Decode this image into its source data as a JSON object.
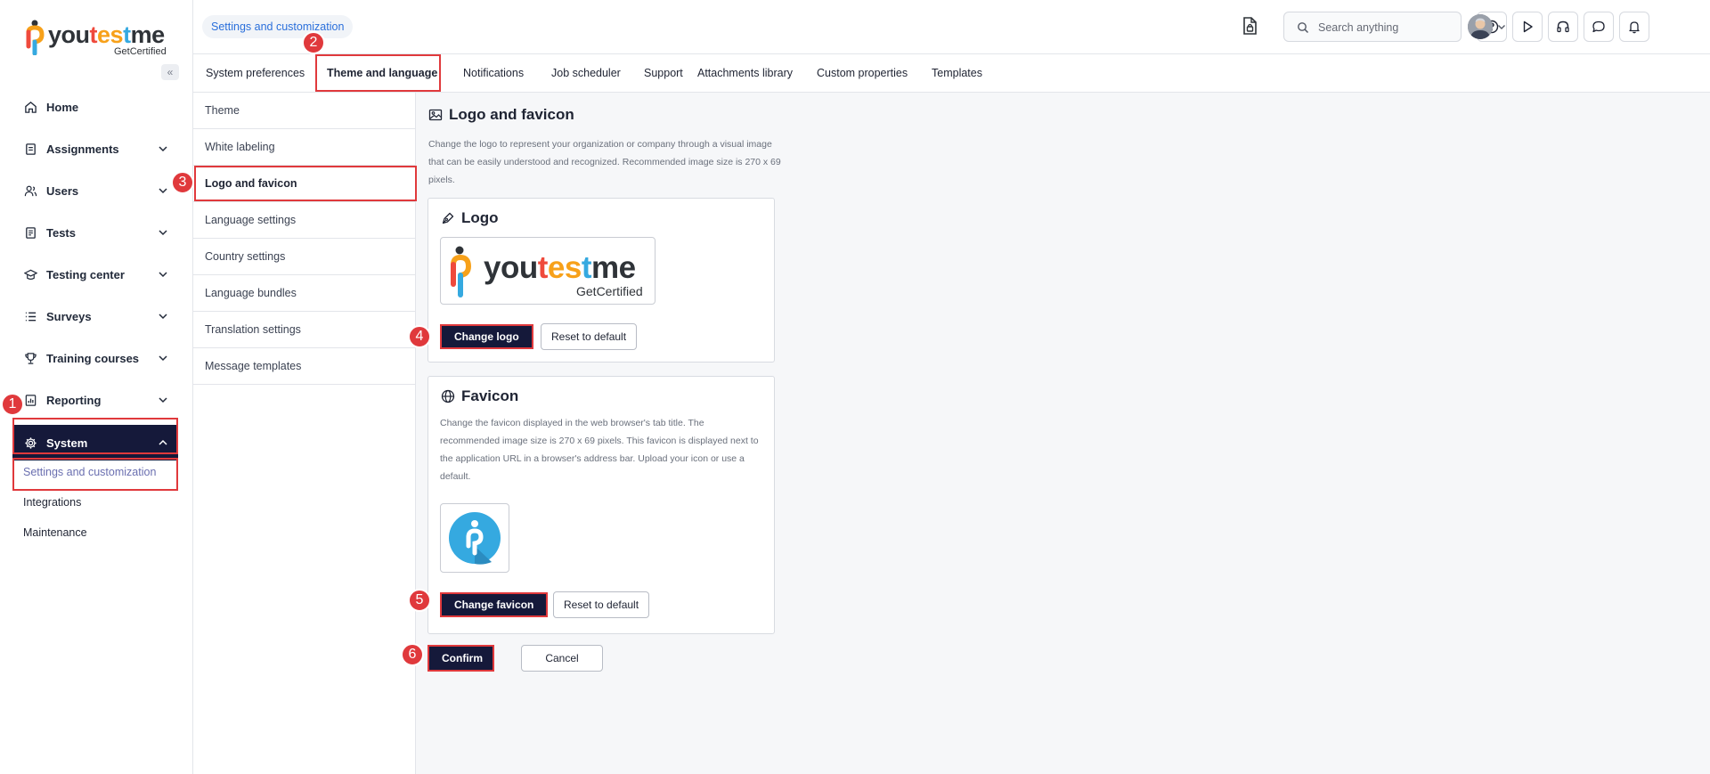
{
  "brand": {
    "word_1": "you",
    "word_2": "t",
    "word_3": "es",
    "word_4": "t",
    "word_5": "me",
    "sub": "GetCertified"
  },
  "sidebar": {
    "items": [
      {
        "label": "Home",
        "icon": "home-icon"
      },
      {
        "label": "Assignments",
        "icon": "assignment-icon"
      },
      {
        "label": "Users",
        "icon": "users-icon"
      },
      {
        "label": "Tests",
        "icon": "tests-icon"
      },
      {
        "label": "Testing center",
        "icon": "testing-center-icon"
      },
      {
        "label": "Surveys",
        "icon": "surveys-icon"
      },
      {
        "label": "Training courses",
        "icon": "trophy-icon"
      },
      {
        "label": "Reporting",
        "icon": "reporting-icon"
      },
      {
        "label": "System",
        "icon": "gear-icon"
      }
    ],
    "sub_items": [
      {
        "label": "Settings and customization"
      },
      {
        "label": "Integrations"
      },
      {
        "label": "Maintenance"
      }
    ]
  },
  "header": {
    "breadcrumb": "Settings and customization",
    "search_placeholder": "Search anything"
  },
  "tabs": [
    {
      "label": "System preferences"
    },
    {
      "label": "Theme and language"
    },
    {
      "label": "Notifications"
    },
    {
      "label": "Job scheduler"
    },
    {
      "label": "Support"
    },
    {
      "label": "Attachments library"
    },
    {
      "label": "Custom properties"
    },
    {
      "label": "Templates"
    }
  ],
  "submenu": [
    {
      "label": "Theme"
    },
    {
      "label": "White labeling"
    },
    {
      "label": "Logo and favicon"
    },
    {
      "label": "Language settings"
    },
    {
      "label": "Country settings"
    },
    {
      "label": "Language bundles"
    },
    {
      "label": "Translation settings"
    },
    {
      "label": "Message templates"
    }
  ],
  "main": {
    "title": "Logo and favicon",
    "description": "Change the logo to represent your organization or company through a visual image that can be easily understood and recognized. Recommended image size is 270 x 69 pixels.",
    "logo_card": {
      "title": "Logo",
      "change_label": "Change logo",
      "reset_label": "Reset to default"
    },
    "favicon_card": {
      "title": "Favicon",
      "description": "Change the favicon displayed in the web browser's tab title. The recommended image size is 270 x 69 pixels. This favicon is displayed next to the application URL in a browser's address bar. Upload your icon or use a default.",
      "change_label": "Change favicon",
      "reset_label": "Reset to default"
    },
    "confirm_label": "Confirm",
    "cancel_label": "Cancel"
  },
  "annotations": [
    "1",
    "2",
    "3",
    "4",
    "5",
    "6"
  ],
  "colors": {
    "accent": "#15193a",
    "highlight": "#e0393c",
    "link": "#2a6fdb"
  }
}
